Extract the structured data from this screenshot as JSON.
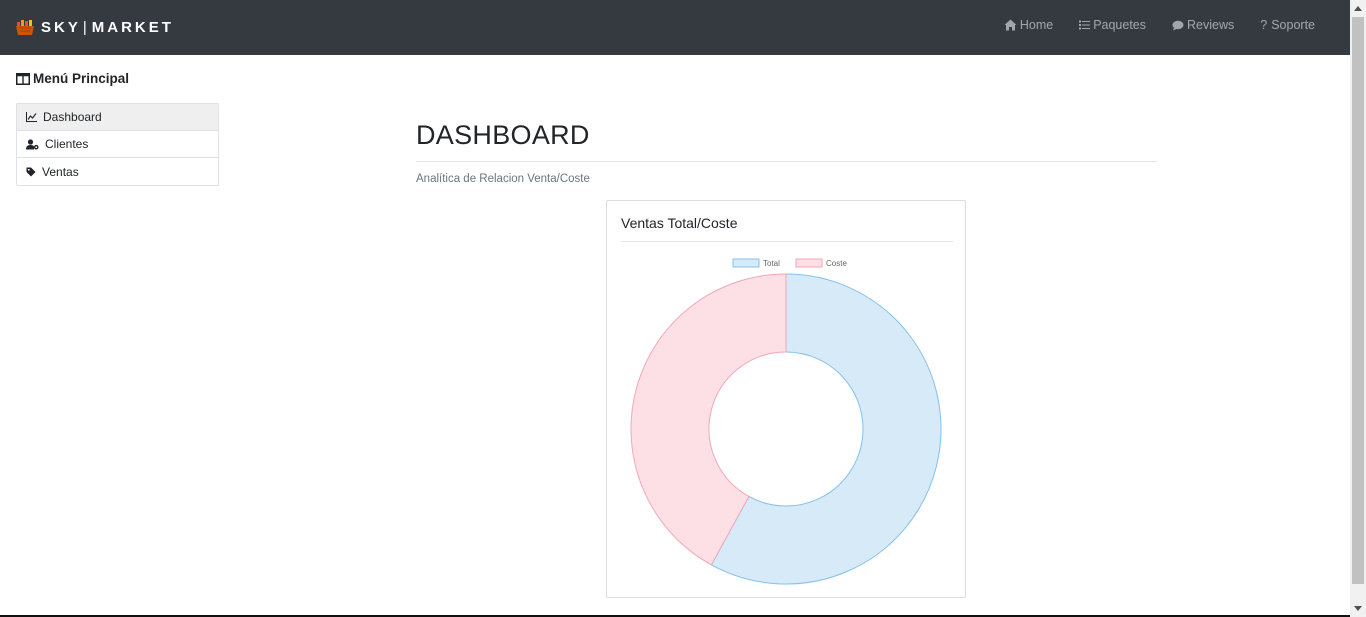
{
  "navbar": {
    "brand_left": "SKY",
    "brand_sep": "|",
    "brand_right": "MARKET",
    "items": [
      {
        "label": "Home",
        "icon": "home-icon"
      },
      {
        "label": "Paquetes",
        "icon": "list-icon"
      },
      {
        "label": "Reviews",
        "icon": "chat-icon"
      },
      {
        "label": "Soporte",
        "icon": "question-icon"
      }
    ]
  },
  "sidebar": {
    "title": "Menú Principal",
    "items": [
      {
        "label": "Dashboard",
        "icon": "chart-line-icon",
        "active": true
      },
      {
        "label": "Clientes",
        "icon": "user-gear-icon",
        "active": false
      },
      {
        "label": "Ventas",
        "icon": "tag-icon",
        "active": false
      }
    ]
  },
  "main": {
    "title": "DASHBOARD",
    "subtitle": "Analítica de Relacion Venta/Coste"
  },
  "card": {
    "title": "Ventas Total/Coste"
  },
  "colors": {
    "navbar_bg": "#343a40",
    "total_fill": "#d6eaf8",
    "total_border": "#85c1e9",
    "coste_fill": "#fde0e6",
    "coste_border": "#f4a6b8"
  },
  "chart_data": {
    "type": "pie",
    "variant": "doughnut",
    "title": "Ventas Total/Coste",
    "legend_position": "top",
    "categories": [
      "Total",
      "Coste"
    ],
    "values": [
      58,
      42
    ]
  }
}
